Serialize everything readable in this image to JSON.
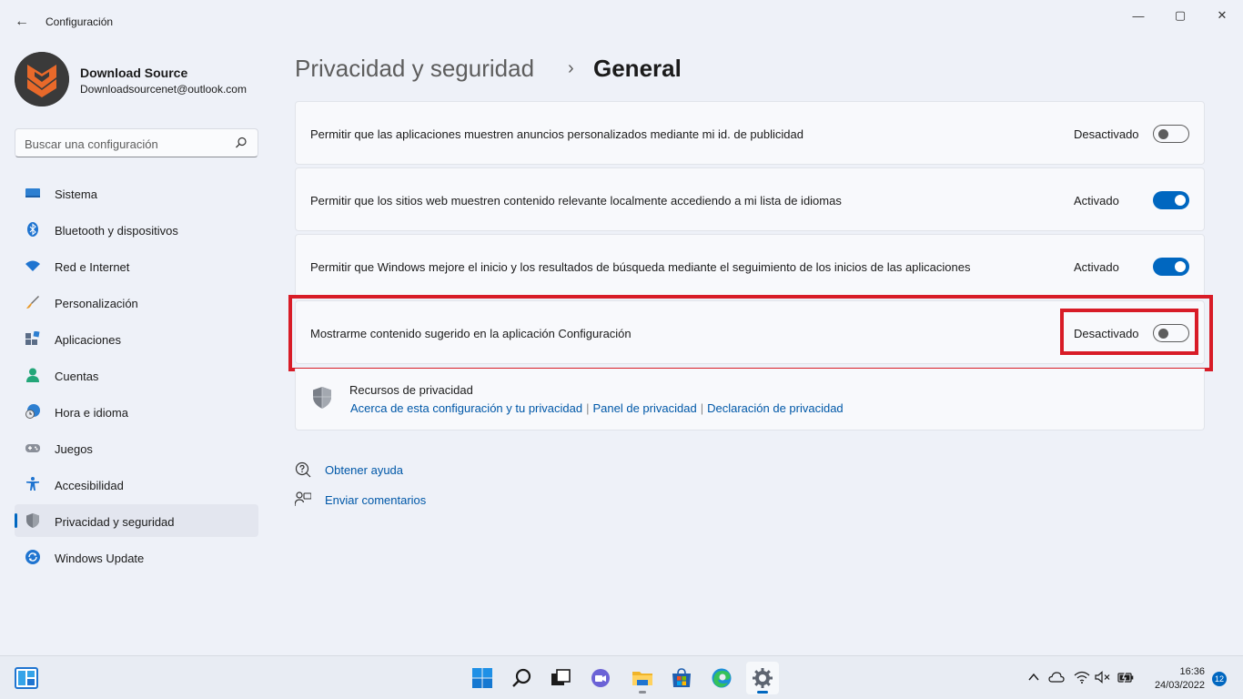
{
  "window": {
    "title": "Configuración",
    "back_symbol": "←",
    "controls": {
      "minimize": "—",
      "maximize": "▢",
      "close": "✕"
    }
  },
  "profile": {
    "name": "Download Source",
    "email": "Downloadsourcenet@outlook.com"
  },
  "search": {
    "placeholder": "Buscar una configuración"
  },
  "sidebar": {
    "items": [
      {
        "label": "Sistema",
        "icon": "monitor-icon"
      },
      {
        "label": "Bluetooth y dispositivos",
        "icon": "bluetooth-icon"
      },
      {
        "label": "Red e Internet",
        "icon": "wifi-icon"
      },
      {
        "label": "Personalización",
        "icon": "brush-icon"
      },
      {
        "label": "Aplicaciones",
        "icon": "apps-icon"
      },
      {
        "label": "Cuentas",
        "icon": "person-icon"
      },
      {
        "label": "Hora e idioma",
        "icon": "globe-clock-icon"
      },
      {
        "label": "Juegos",
        "icon": "gamepad-icon"
      },
      {
        "label": "Accesibilidad",
        "icon": "accessibility-icon"
      },
      {
        "label": "Privacidad y seguridad",
        "icon": "shield-icon",
        "active": true
      },
      {
        "label": "Windows Update",
        "icon": "update-icon"
      }
    ]
  },
  "breadcrumb": {
    "parent": "Privacidad y seguridad",
    "separator": "›",
    "current": "General"
  },
  "settings": [
    {
      "label": "Permitir que las aplicaciones muestren anuncios personalizados mediante mi id. de publicidad",
      "state": "Desactivado",
      "on": false
    },
    {
      "label": "Permitir que los sitios web muestren contenido relevante localmente accediendo a mi lista de idiomas",
      "state": "Activado",
      "on": true
    },
    {
      "label": "Permitir que Windows mejore el inicio y los resultados de búsqueda mediante el seguimiento de los inicios de las aplicaciones",
      "state": "Activado",
      "on": true
    },
    {
      "label": "Mostrarme contenido sugerido en la aplicación Configuración",
      "state": "Desactivado",
      "on": false
    }
  ],
  "privacy_resources": {
    "title": "Recursos de privacidad",
    "links": [
      "Acerca de esta configuración y tu privacidad",
      "Panel de privacidad",
      "Declaración de privacidad"
    ],
    "separator": "|"
  },
  "help": {
    "get_help": "Obtener ayuda",
    "feedback": "Enviar comentarios"
  },
  "taskbar": {
    "apps": [
      "start-icon",
      "search-icon",
      "task-view-icon",
      "teams-chat-icon",
      "file-explorer-icon",
      "store-icon",
      "edge-icon",
      "settings-icon"
    ],
    "active_app": "settings-icon",
    "time": "16:36",
    "date": "24/03/2022",
    "notification_count": "12"
  },
  "colors": {
    "accent": "#0067c0",
    "highlight": "#d81c27",
    "background": "#eef1f8"
  }
}
